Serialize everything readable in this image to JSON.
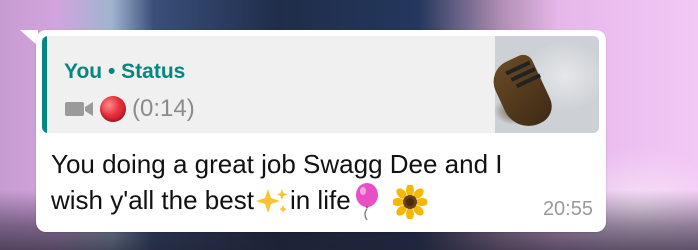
{
  "status_quote": {
    "sender": "You",
    "separator": "•",
    "label": "Status",
    "duration": "(0:14)"
  },
  "message": {
    "line1": "You doing a great job Swagg Dee and I",
    "line2_before": "wish y'all the best",
    "line2_after": "in life",
    "timestamp": "20:55"
  },
  "icons": [
    "video-camera-icon",
    "record-dot-icon",
    "sparkles-emoji",
    "balloon-emoji",
    "sunflower-emoji"
  ],
  "colors": {
    "accent": "#05867e",
    "bubble": "#ffffff",
    "quote_bg": "#f0f0f0",
    "timestamp": "#9a9a9a"
  }
}
